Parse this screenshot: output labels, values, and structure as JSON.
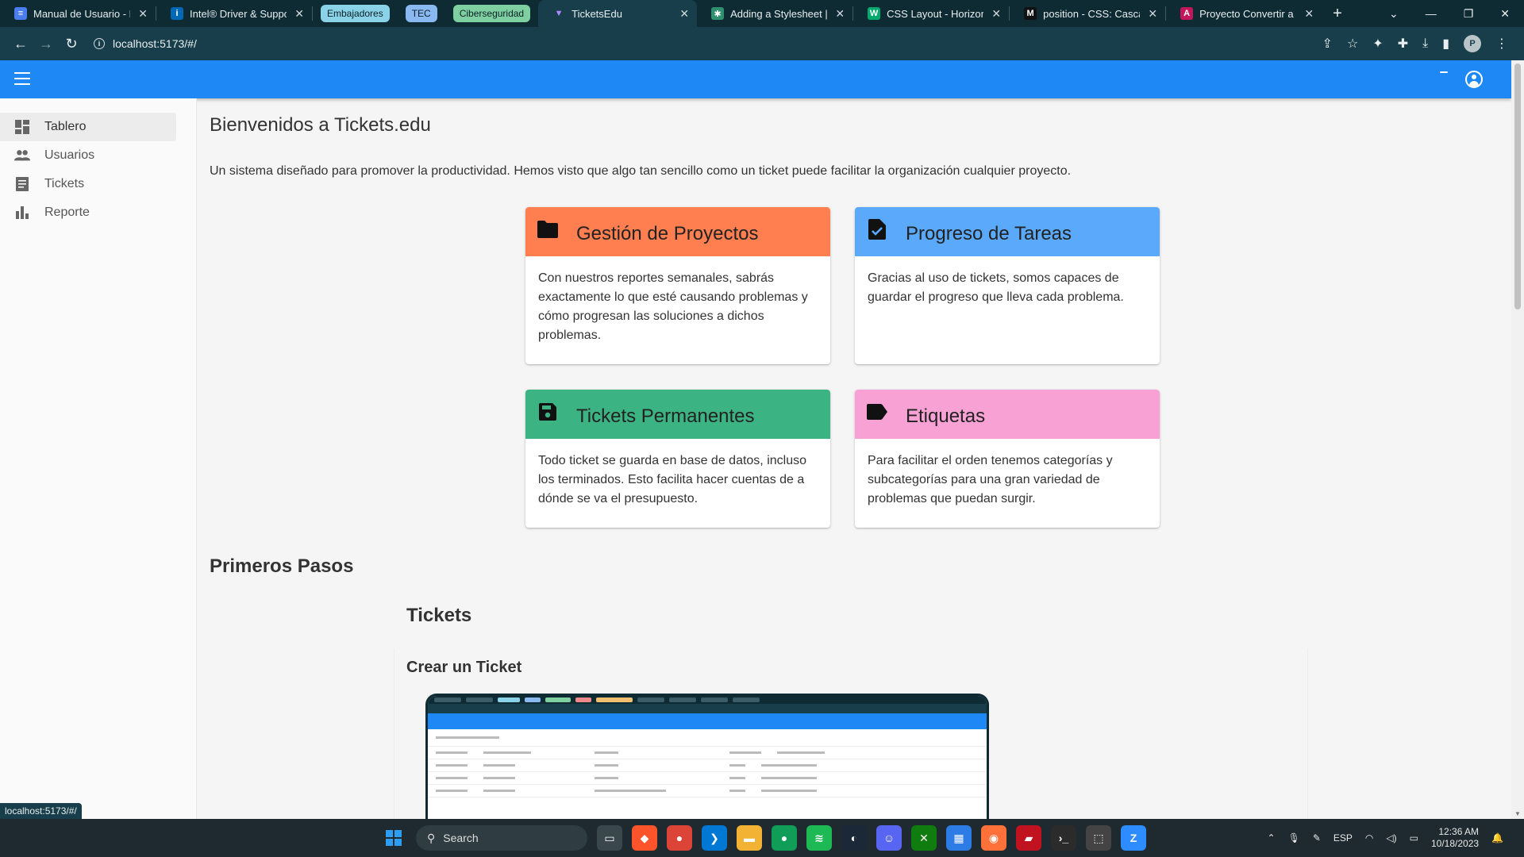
{
  "browser": {
    "tabs": [
      {
        "title": "Manual de Usuario - Do",
        "favicon_color": "#4a7df0",
        "favicon_glyph": "≡"
      },
      {
        "title": "Intel® Driver & Support",
        "favicon_color": "#0068b5",
        "favicon_glyph": "i"
      }
    ],
    "groups": [
      {
        "label": "Embajadores"
      },
      {
        "label": "TEC"
      },
      {
        "label": "Ciberseguridad"
      }
    ],
    "tabs_after": [
      {
        "title": "TicketsEdu",
        "favicon_color": "#7c4dff",
        "favicon_glyph": "▼",
        "active": true
      },
      {
        "title": "Adding a Stylesheet | Cr",
        "favicon_color": "#2f8f6f",
        "favicon_glyph": "✱"
      },
      {
        "title": "CSS Layout - Horizontal",
        "favicon_color": "#04aa6d",
        "favicon_glyph": "W"
      },
      {
        "title": "position - CSS: Cascadin",
        "favicon_color": "#111111",
        "favicon_glyph": "M"
      },
      {
        "title": "Proyecto Convertir a GIF",
        "favicon_color": "#c2185b",
        "favicon_glyph": "A"
      }
    ],
    "url": "localhost:5173/#/",
    "status_url": "localhost:5173/#/",
    "profile_initial": "P"
  },
  "sidebar": {
    "items": [
      {
        "label": "Tablero",
        "icon": "dashboard-icon",
        "active": true
      },
      {
        "label": "Usuarios",
        "icon": "users-icon"
      },
      {
        "label": "Tickets",
        "icon": "receipt-icon"
      },
      {
        "label": "Reporte",
        "icon": "bar-chart-icon"
      }
    ]
  },
  "main": {
    "welcome": "Bienvenidos a Tickets.edu",
    "intro": "Un sistema diseñado para promover la productividad. Hemos visto que algo tan sencillo como un ticket puede facilitar la organización cualquier proyecto.",
    "cards": [
      {
        "title": "Gestión de Proyectos",
        "icon": "folder-icon",
        "color": "#ff7f50",
        "text": "Con nuestros reportes semanales, sabrás exactamente lo que esté causando problemas y cómo progresan las soluciones a dichos problemas."
      },
      {
        "title": "Progreso de Tareas",
        "icon": "task-check-icon",
        "color": "#5aa9fa",
        "text": "Gracias al uso de tickets, somos capaces de guardar el progreso que lleva cada problema."
      },
      {
        "title": "Tickets Permanentes",
        "icon": "save-icon",
        "color": "#3cb383",
        "text": "Todo ticket se guarda en base de datos, incluso los terminados. Esto facilita hacer cuentas de a dónde se va el presupuesto."
      },
      {
        "title": "Etiquetas",
        "icon": "label-icon",
        "color": "#f7a1d4",
        "text": "Para facilitar el orden tenemos categorías y subcategorías para una gran variedad de problemas que puedan surgir."
      }
    ],
    "section_title": "Primeros Pasos",
    "sub_title": "Tickets",
    "sub2_title": "Crear un Ticket"
  },
  "taskbar": {
    "search_label": "Search",
    "language": "ESP",
    "time": "12:36 AM",
    "date": "10/18/2023"
  },
  "colors": {
    "appbar": "#1e88f5",
    "tabstrip": "#0e2a33",
    "toolbar": "#173e4a"
  }
}
